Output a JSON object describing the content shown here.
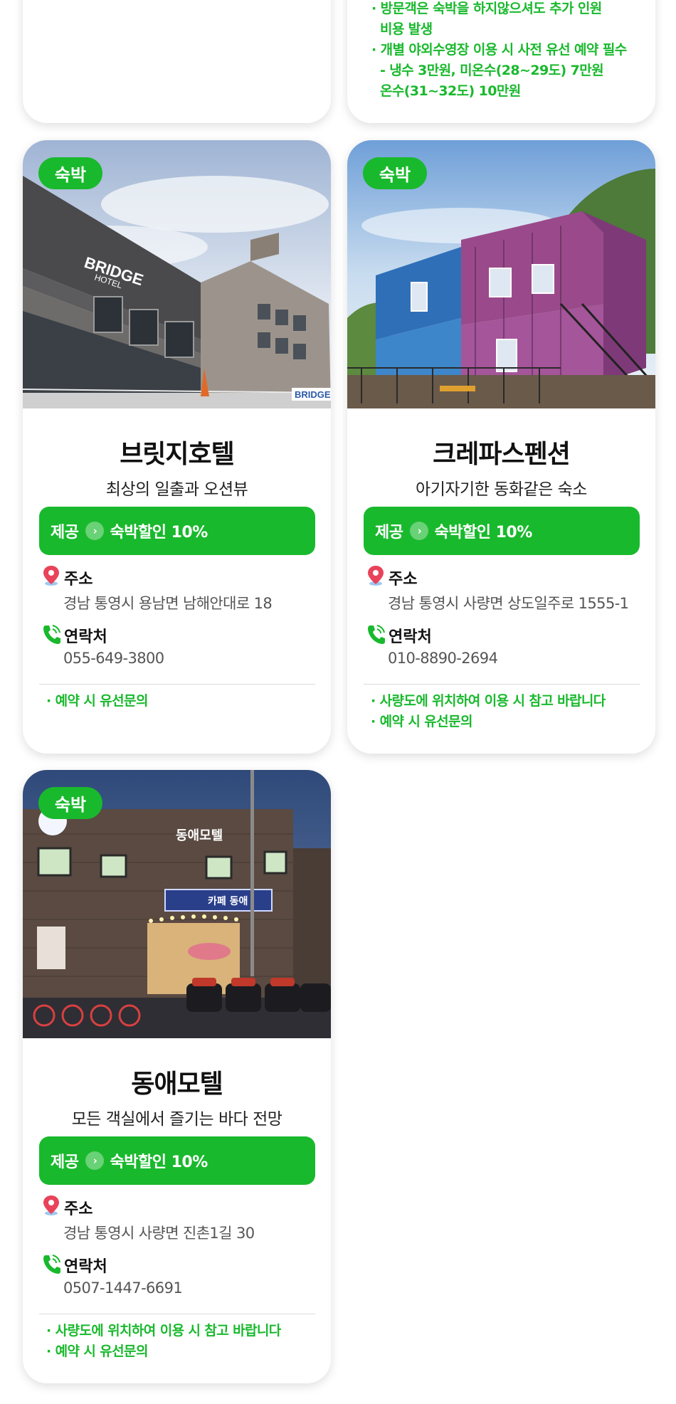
{
  "top_card_notes": [
    "· 방문객은 숙박을 하지않으셔도 추가 인원",
    "  비용 발생",
    "· 개별 야외수영장 이용 시 사전 유선 예약 필수",
    "  - 냉수 3만원, 미온수(28~29도) 7만원",
    "    온수(31~32도) 10만원"
  ],
  "labels": {
    "provide": "제공",
    "address": "주소",
    "contact": "연락처"
  },
  "cards": [
    {
      "badge": "숙박",
      "name": "브릿지호텔",
      "tagline": "최상의 일출과 오션뷰",
      "offer": "숙박할인 10%",
      "address": "경남 통영시 용남면 남해안대로 18",
      "phone": "055-649-3800",
      "notes": [
        "· 예약 시 유선문의"
      ],
      "photo_sign": "BRIDGE",
      "photo_sign2": "HOTEL"
    },
    {
      "badge": "숙박",
      "name": "크레파스펜션",
      "tagline": "아기자기한 동화같은 숙소",
      "offer": "숙박할인 10%",
      "address": "경남 통영시 사량면 상도일주로 1555-1",
      "phone": "010-8890-2694",
      "notes": [
        "· 사량도에 위치하여 이용 시 참고 바랍니다",
        "· 예약 시 유선문의"
      ]
    },
    {
      "badge": "숙박",
      "name": "동애모텔",
      "tagline": "모든 객실에서 즐기는 바다 전망",
      "offer": "숙박할인 10%",
      "address": "경남 통영시 사량면 진촌1길 30",
      "phone": "0507-1447-6691",
      "notes": [
        "· 사량도에 위치하여 이용 시 참고 바랍니다",
        "· 예약 시 유선문의"
      ],
      "photo_sign": "동애모텔",
      "photo_sign2": "카페 동애"
    }
  ],
  "colors": {
    "accent": "#19b92d",
    "pin": "#e8435a",
    "phone": "#19b92d"
  },
  "icons": {
    "address": "location-pin-icon",
    "contact": "phone-icon",
    "offer_arrow": "chevron-right-icon"
  }
}
